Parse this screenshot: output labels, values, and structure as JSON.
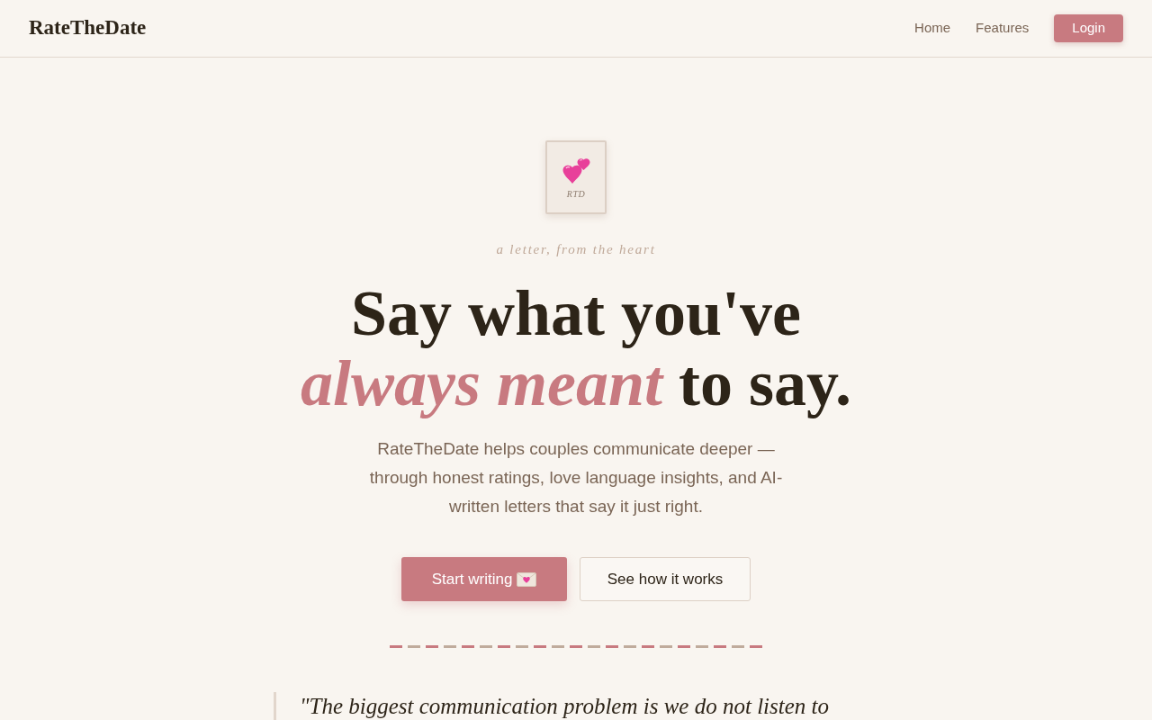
{
  "nav": {
    "logo": "RateTheDate",
    "links": [
      {
        "label": "Home"
      },
      {
        "label": "Features"
      }
    ],
    "login_button": "Login"
  },
  "hero": {
    "stamp_text": "RTD",
    "tagline": "a letter, from the heart",
    "headline": "Say what you've *always meant* to say.",
    "description": "RateTheDate helps couples communicate deeper — through honest ratings, love language insights, and AI-written letters that say it just right.",
    "buttons": [
      {
        "label": "Start writing",
        "kind": "primary"
      },
      {
        "label": "See how it works",
        "kind": "secondary"
      }
    ]
  },
  "quote": {
    "text": "\"The biggest communication problem is we do not listen to"
  }
}
